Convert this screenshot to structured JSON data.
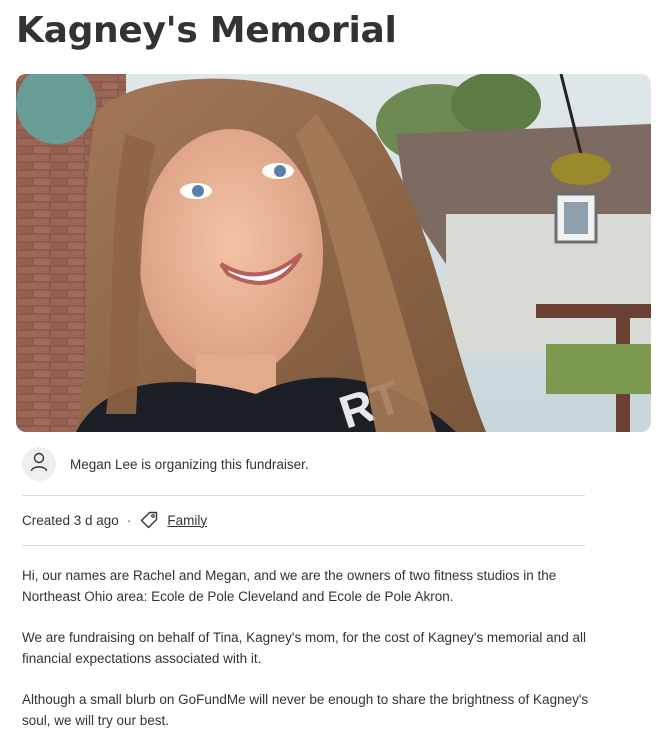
{
  "page": {
    "title": "Kagney's Memorial"
  },
  "organizer": {
    "icon": "user-icon",
    "text": "Megan Lee is organizing this fundraiser."
  },
  "meta": {
    "created": "Created 3 d ago",
    "separator": "·",
    "category_icon": "tag-icon",
    "category": "Family"
  },
  "story": [
    "Hi, our names are Rachel and Megan, and we are the owners of two fitness studios in the Northeast Ohio area: Ecole de Pole Cleveland and Ecole de Pole Akron.",
    "We are fundraising on behalf of Tina, Kagney's mom, for the cost of Kagney's memorial and all financial expectations associated with it.",
    "Although a small blurb on GoFundMe will never be enough to share the brightness of Kagney's soul, we will try our best."
  ],
  "colors": {
    "text": "#333333",
    "divider": "#dadada",
    "avatar_bg": "#f0efee"
  }
}
